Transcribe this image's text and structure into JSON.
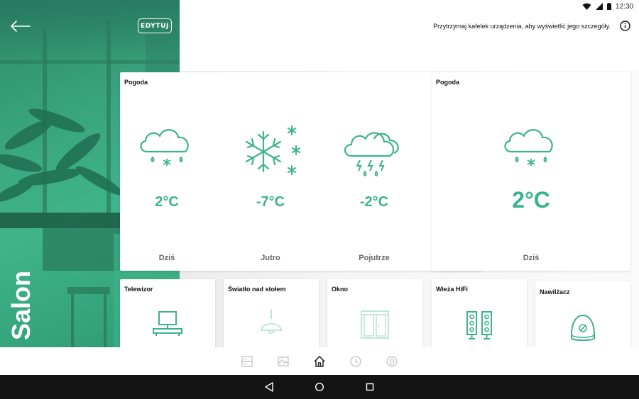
{
  "room": {
    "name": "Salon",
    "edit_label": "EDYTUJ"
  },
  "status_bar": {
    "time": "12:30"
  },
  "header": {
    "hint": "Przytrzymaj kafelek urządzenia, aby wyświetlić jego szczegóły."
  },
  "weather_main": {
    "title": "Pogoda",
    "days": [
      {
        "label": "Dziś",
        "temp": "2°C",
        "icon": "cloud-rain-snow-icon"
      },
      {
        "label": "Jutro",
        "temp": "-7°C",
        "icon": "snowflake-icon"
      },
      {
        "label": "Pojutrze",
        "temp": "-2°C",
        "icon": "storm-icon"
      }
    ]
  },
  "weather_small": {
    "title": "Pogoda",
    "label": "Dziś",
    "temp": "2°C",
    "icon": "cloud-rain-snow-icon"
  },
  "devices": [
    {
      "name": "Telewizor",
      "icon": "tv-icon",
      "active": true
    },
    {
      "name": "Światło nad stołem",
      "icon": "lamp-icon",
      "active": false
    },
    {
      "name": "Okno",
      "icon": "window-icon",
      "active": false
    },
    {
      "name": "Wieża HiFi",
      "icon": "speakers-icon",
      "active": true
    },
    {
      "name": "Nawilżacz",
      "icon": "humidifier-icon",
      "active": true
    }
  ],
  "nav": [
    "devices-nav-icon",
    "scenes-nav-icon",
    "home-nav-icon",
    "history-nav-icon",
    "settings-nav-icon"
  ],
  "colors": {
    "accent": "#3cb38c",
    "inactive": "#bfe5d7",
    "panel": "#3aa580"
  }
}
